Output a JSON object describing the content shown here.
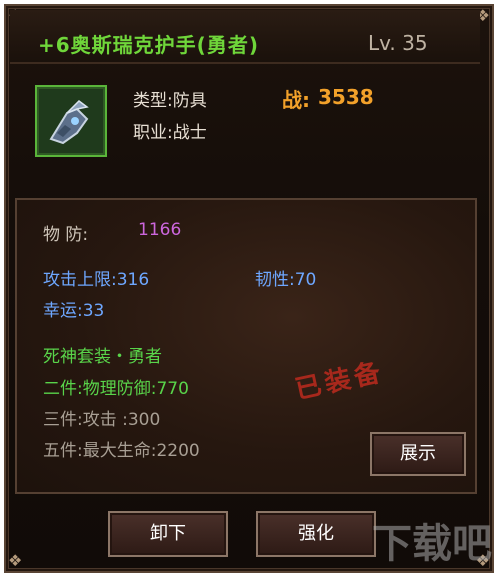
{
  "item": {
    "name": "+6奥斯瑞克护手(勇者)",
    "level": "Lv. 35",
    "enhance": "+6",
    "icon": "gauntlet-icon"
  },
  "info": {
    "type_label": "类型:防具",
    "class_label": "职业:战士",
    "power_label": "战:",
    "power_value": "3538"
  },
  "stats": {
    "defense_label": "物   防:",
    "defense_value": "1166",
    "attack_max": "攻击上限:316",
    "toughness": "韧性:70",
    "luck": "幸运:33"
  },
  "set": {
    "name": "死神套装・勇者",
    "two_piece": "二件:物理防御:770",
    "three_piece": "三件:攻击         :300",
    "five_piece": "五件:最大生命:2200"
  },
  "status_stamp": "已装备",
  "buttons": {
    "show": "展示",
    "unequip": "卸下",
    "enhance": "强化"
  },
  "colors": {
    "name": "#6fd63a",
    "power": "#f2a12a",
    "defense": "#cc66dd",
    "stat_blue": "#6ea7ff",
    "set_green": "#59d44a",
    "stamp": "#b52a1d"
  },
  "watermark": "下载吧"
}
